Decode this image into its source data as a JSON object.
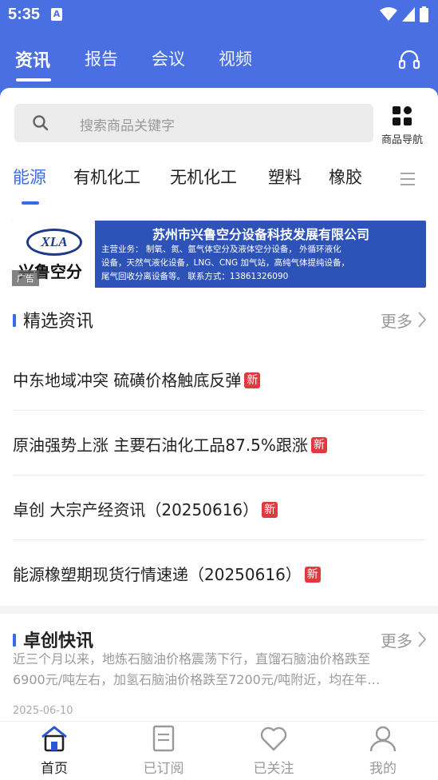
{
  "status_bar": {
    "time": "5:35",
    "notification_icon": "A"
  },
  "top_tabs": [
    {
      "label": "资讯",
      "active": true
    },
    {
      "label": "报告",
      "active": false
    },
    {
      "label": "会议",
      "active": false
    },
    {
      "label": "视频",
      "active": false
    }
  ],
  "search": {
    "placeholder": "搜索商品关键字",
    "nav_label": "商品导航"
  },
  "categories": [
    {
      "label": "能源",
      "active": true
    },
    {
      "label": "有机化工",
      "active": false
    },
    {
      "label": "无机化工",
      "active": false
    },
    {
      "label": "塑料",
      "active": false
    },
    {
      "label": "橡胶",
      "active": false
    }
  ],
  "banner": {
    "logo_abbr": "XLA",
    "logo_name": "兴鲁空分",
    "ad_label": "广告",
    "title": "苏州市兴鲁空分设备科技发展有限公司",
    "desc_line1": "主营业务：  制氧、氮、氩气体空分及液体空分设备， 外循环液化",
    "desc_line2": "设备，天然气液化设备，LNG、CNG 加气站，高纯气体提纯设备，",
    "desc_line3": "尾气回收分离设备等。       联系方式：13861326090"
  },
  "featured": {
    "title": "精选资讯",
    "more": "更多",
    "badge": "新",
    "items": [
      {
        "title": "中东地域冲突  硫磺价格触底反弹"
      },
      {
        "title": "原油强势上涨  主要石油化工品87.5%跟涨"
      },
      {
        "title": "卓创 大宗产经资讯（20250616）"
      },
      {
        "title": "能源橡塑期现货行情速递（20250616）"
      }
    ]
  },
  "quick_news": {
    "title": "卓创快讯",
    "more": "更多",
    "line1": "近三个月以来，地炼石脑油价格震荡下行，直馏石脑油价格跌至",
    "line2": "6900元/吨左右，加氢石脑油价格跌至7200元/吨附近，均在年…",
    "date": "2025-06-10"
  },
  "bottom_nav": [
    {
      "label": "首页",
      "active": true
    },
    {
      "label": "已订阅",
      "active": false
    },
    {
      "label": "已关注",
      "active": false
    },
    {
      "label": "我的",
      "active": false
    }
  ],
  "colors": {
    "primary": "#4a6fe3",
    "accent": "#3a6ae8",
    "badge": "#e0393e"
  }
}
